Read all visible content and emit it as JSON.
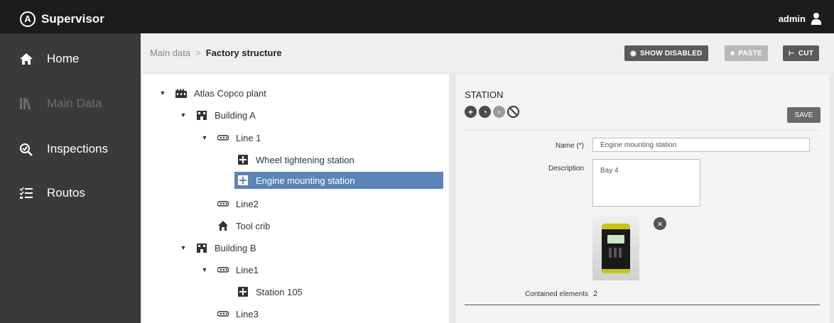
{
  "app": {
    "title": "Supervisor",
    "logo_letter": "A"
  },
  "user": {
    "name": "admin",
    "icon": "user-icon"
  },
  "sidebar": {
    "items": [
      {
        "label": "Home",
        "icon": "home-icon",
        "enabled": true
      },
      {
        "label": "Main Data",
        "icon": "books-icon",
        "enabled": false
      },
      {
        "label": "Inspections",
        "icon": "inspection-icon",
        "enabled": true
      },
      {
        "label": "Routos",
        "icon": "list-icon",
        "enabled": true
      }
    ]
  },
  "breadcrumb": {
    "parent": "Main data",
    "separator": ">",
    "current": "Factory structure"
  },
  "toolbar": {
    "show_disabled": "SHOW DISABLED",
    "paste": "PASTE",
    "cut": "CUT"
  },
  "tree": [
    {
      "label": "Atlas Copco plant",
      "icon": "factory-icon",
      "expanded": true,
      "level": 0
    },
    {
      "label": "Building A",
      "icon": "building-icon",
      "expanded": true,
      "level": 1
    },
    {
      "label": "Line 1",
      "icon": "line-icon",
      "expanded": true,
      "level": 2
    },
    {
      "label": "Wheel tightening station",
      "icon": "station-icon",
      "level": 3
    },
    {
      "label": "Engine mounting station",
      "icon": "station-icon",
      "level": 3,
      "selected": true
    },
    {
      "label": "Line2",
      "icon": "line-icon",
      "level": 2
    },
    {
      "label": "Tool crib",
      "icon": "house-icon",
      "level": 2
    },
    {
      "label": "Building B",
      "icon": "building-icon",
      "expanded": true,
      "level": 1
    },
    {
      "label": "Line1",
      "icon": "line-icon",
      "expanded": true,
      "level": 2
    },
    {
      "label": "Station 105",
      "icon": "station-icon",
      "level": 3
    },
    {
      "label": "Line3",
      "icon": "line-icon",
      "level": 2
    }
  ],
  "detail": {
    "title": "STATION",
    "save_label": "SAVE",
    "name_label": "Name (*)",
    "name_value": "Engine mounting station",
    "description_label": "Description",
    "description_value": "Bay 4",
    "remove_icon": "close-icon",
    "contained_label": "Contained elements",
    "contained_value": "2"
  },
  "colors": {
    "topbar": "#1c1c1c",
    "sidebar": "#3a3a3a",
    "selection": "#5b84b8",
    "button": "#5a5a5a"
  }
}
